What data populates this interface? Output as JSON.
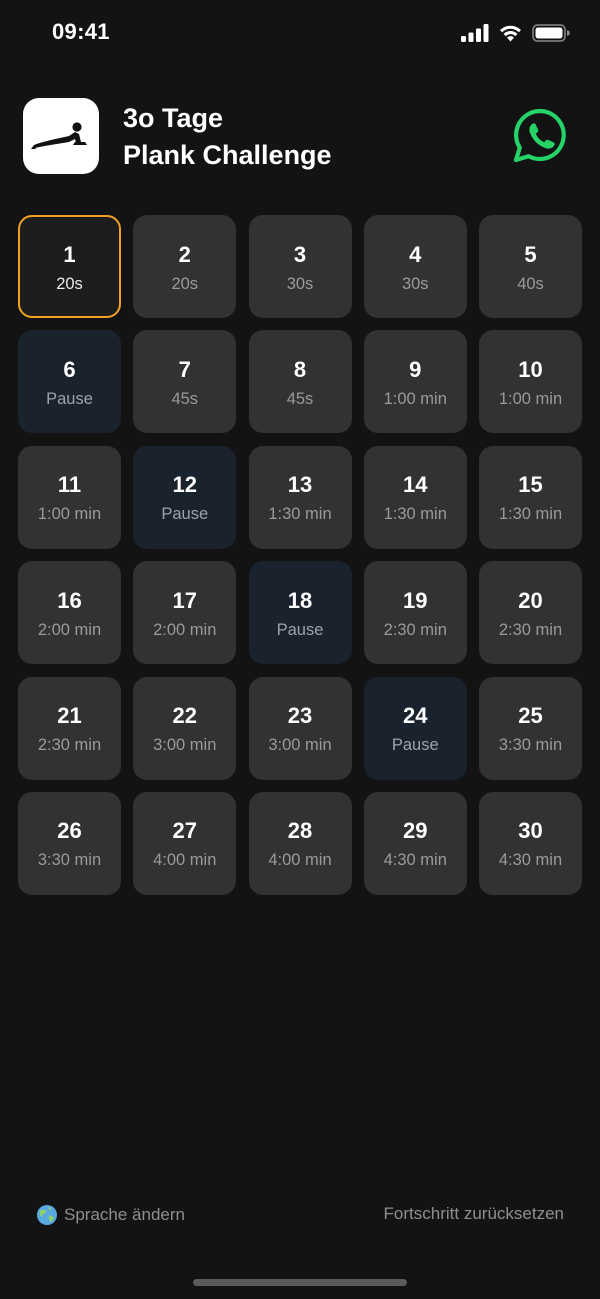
{
  "status_bar": {
    "time": "09:41"
  },
  "header": {
    "app_icon": "plank-icon",
    "title_line1": "3o Tage",
    "title_line2": "Plank Challenge",
    "share_icon": "whatsapp-icon"
  },
  "colors": {
    "background": "#131313",
    "tile": "#323232",
    "rest_tile": "#19222d",
    "current_border": "#f0a024",
    "whatsapp": "#25d366"
  },
  "current_day": 1,
  "days": [
    {
      "day": "1",
      "duration": "20s",
      "type": "current"
    },
    {
      "day": "2",
      "duration": "20s",
      "type": "workout"
    },
    {
      "day": "3",
      "duration": "30s",
      "type": "workout"
    },
    {
      "day": "4",
      "duration": "30s",
      "type": "workout"
    },
    {
      "day": "5",
      "duration": "40s",
      "type": "workout"
    },
    {
      "day": "6",
      "duration": "Pause",
      "type": "rest"
    },
    {
      "day": "7",
      "duration": "45s",
      "type": "workout"
    },
    {
      "day": "8",
      "duration": "45s",
      "type": "workout"
    },
    {
      "day": "9",
      "duration": "1:00 min",
      "type": "workout"
    },
    {
      "day": "10",
      "duration": "1:00 min",
      "type": "workout"
    },
    {
      "day": "11",
      "duration": "1:00 min",
      "type": "workout"
    },
    {
      "day": "12",
      "duration": "Pause",
      "type": "rest"
    },
    {
      "day": "13",
      "duration": "1:30 min",
      "type": "workout"
    },
    {
      "day": "14",
      "duration": "1:30 min",
      "type": "workout"
    },
    {
      "day": "15",
      "duration": "1:30 min",
      "type": "workout"
    },
    {
      "day": "16",
      "duration": "2:00 min",
      "type": "workout"
    },
    {
      "day": "17",
      "duration": "2:00 min",
      "type": "workout"
    },
    {
      "day": "18",
      "duration": "Pause",
      "type": "rest"
    },
    {
      "day": "19",
      "duration": "2:30 min",
      "type": "workout"
    },
    {
      "day": "20",
      "duration": "2:30 min",
      "type": "workout"
    },
    {
      "day": "21",
      "duration": "2:30 min",
      "type": "workout"
    },
    {
      "day": "22",
      "duration": "3:00 min",
      "type": "workout"
    },
    {
      "day": "23",
      "duration": "3:00 min",
      "type": "workout"
    },
    {
      "day": "24",
      "duration": "Pause",
      "type": "rest"
    },
    {
      "day": "25",
      "duration": "3:30 min",
      "type": "workout"
    },
    {
      "day": "26",
      "duration": "3:30 min",
      "type": "workout"
    },
    {
      "day": "27",
      "duration": "4:00 min",
      "type": "workout"
    },
    {
      "day": "28",
      "duration": "4:00 min",
      "type": "workout"
    },
    {
      "day": "29",
      "duration": "4:30 min",
      "type": "workout"
    },
    {
      "day": "30",
      "duration": "4:30 min",
      "type": "workout"
    }
  ],
  "footer": {
    "language_icon": "globe-icon",
    "language_label": "Sprache ändern",
    "reset_label": "Fortschritt zurücksetzen"
  }
}
